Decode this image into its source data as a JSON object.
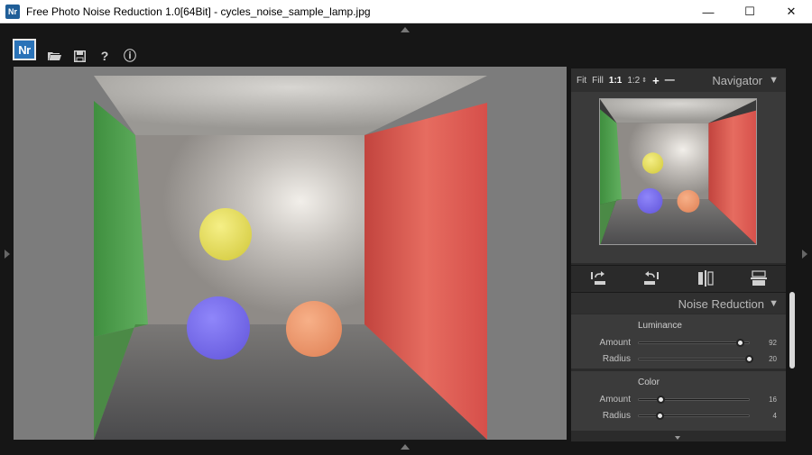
{
  "window": {
    "title": "Free Photo Noise Reduction 1.0[64Bit] - cycles_noise_sample_lamp.jpg",
    "app_icon_text": "Nr",
    "minimize": "—",
    "maximize": "☐",
    "close": "✕"
  },
  "logo": {
    "text": "Nr"
  },
  "toolbar": {
    "open_icon": "folder-icon",
    "save_icon": "save-icon",
    "help_label": "?",
    "info_label": "ⓘ"
  },
  "navigator": {
    "title": "Navigator",
    "zoom_options": [
      "Fit",
      "Fill",
      "1:1",
      "1:2"
    ],
    "active_zoom": "1:1",
    "zoom_in": "+",
    "zoom_out": "—",
    "caret": "▼"
  },
  "noise_reduction": {
    "title": "Noise Reduction",
    "caret": "▼",
    "groups": [
      {
        "title": "Luminance",
        "rows": [
          {
            "label": "Amount",
            "value": "92"
          },
          {
            "label": "Radius",
            "value": "20"
          }
        ]
      },
      {
        "title": "Color",
        "rows": [
          {
            "label": "Amount",
            "value": "16"
          },
          {
            "label": "Radius",
            "value": "4"
          }
        ]
      }
    ]
  },
  "sliders": {
    "luminance_amount_fraction": 0.92,
    "luminance_radius_fraction": 1.0,
    "color_amount_fraction": 0.2,
    "color_radius_fraction": 0.19
  },
  "colors": {
    "wall_left": "#4fa24f",
    "wall_right": "#d9524c",
    "sphere_yellow": "#e8e062",
    "sphere_blue": "#7f73f0",
    "sphere_orange": "#f09a6e"
  }
}
